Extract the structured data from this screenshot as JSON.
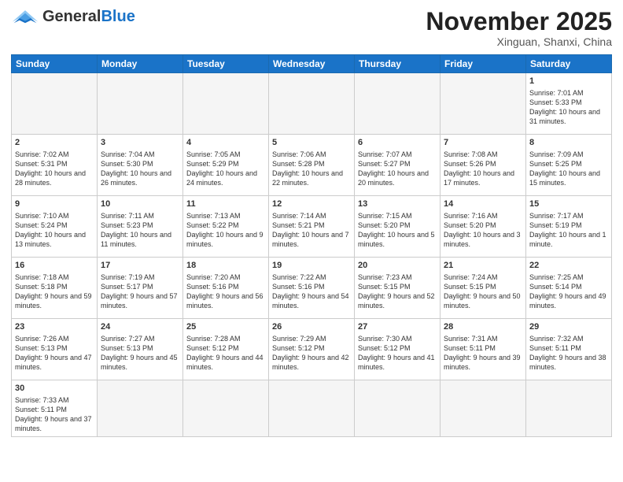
{
  "logo": {
    "general": "General",
    "blue": "Blue"
  },
  "header": {
    "month_title": "November 2025",
    "location": "Xinguan, Shanxi, China"
  },
  "weekdays": [
    "Sunday",
    "Monday",
    "Tuesday",
    "Wednesday",
    "Thursday",
    "Friday",
    "Saturday"
  ],
  "weeks": [
    [
      {
        "day": "",
        "empty": true
      },
      {
        "day": "",
        "empty": true
      },
      {
        "day": "",
        "empty": true
      },
      {
        "day": "",
        "empty": true
      },
      {
        "day": "",
        "empty": true
      },
      {
        "day": "",
        "empty": true
      },
      {
        "day": "1",
        "sunrise": "Sunrise: 7:01 AM",
        "sunset": "Sunset: 5:33 PM",
        "daylight": "Daylight: 10 hours and 31 minutes."
      }
    ],
    [
      {
        "day": "2",
        "sunrise": "Sunrise: 7:02 AM",
        "sunset": "Sunset: 5:31 PM",
        "daylight": "Daylight: 10 hours and 28 minutes."
      },
      {
        "day": "3",
        "sunrise": "Sunrise: 7:04 AM",
        "sunset": "Sunset: 5:30 PM",
        "daylight": "Daylight: 10 hours and 26 minutes."
      },
      {
        "day": "4",
        "sunrise": "Sunrise: 7:05 AM",
        "sunset": "Sunset: 5:29 PM",
        "daylight": "Daylight: 10 hours and 24 minutes."
      },
      {
        "day": "5",
        "sunrise": "Sunrise: 7:06 AM",
        "sunset": "Sunset: 5:28 PM",
        "daylight": "Daylight: 10 hours and 22 minutes."
      },
      {
        "day": "6",
        "sunrise": "Sunrise: 7:07 AM",
        "sunset": "Sunset: 5:27 PM",
        "daylight": "Daylight: 10 hours and 20 minutes."
      },
      {
        "day": "7",
        "sunrise": "Sunrise: 7:08 AM",
        "sunset": "Sunset: 5:26 PM",
        "daylight": "Daylight: 10 hours and 17 minutes."
      },
      {
        "day": "8",
        "sunrise": "Sunrise: 7:09 AM",
        "sunset": "Sunset: 5:25 PM",
        "daylight": "Daylight: 10 hours and 15 minutes."
      }
    ],
    [
      {
        "day": "9",
        "sunrise": "Sunrise: 7:10 AM",
        "sunset": "Sunset: 5:24 PM",
        "daylight": "Daylight: 10 hours and 13 minutes."
      },
      {
        "day": "10",
        "sunrise": "Sunrise: 7:11 AM",
        "sunset": "Sunset: 5:23 PM",
        "daylight": "Daylight: 10 hours and 11 minutes."
      },
      {
        "day": "11",
        "sunrise": "Sunrise: 7:13 AM",
        "sunset": "Sunset: 5:22 PM",
        "daylight": "Daylight: 10 hours and 9 minutes."
      },
      {
        "day": "12",
        "sunrise": "Sunrise: 7:14 AM",
        "sunset": "Sunset: 5:21 PM",
        "daylight": "Daylight: 10 hours and 7 minutes."
      },
      {
        "day": "13",
        "sunrise": "Sunrise: 7:15 AM",
        "sunset": "Sunset: 5:20 PM",
        "daylight": "Daylight: 10 hours and 5 minutes."
      },
      {
        "day": "14",
        "sunrise": "Sunrise: 7:16 AM",
        "sunset": "Sunset: 5:20 PM",
        "daylight": "Daylight: 10 hours and 3 minutes."
      },
      {
        "day": "15",
        "sunrise": "Sunrise: 7:17 AM",
        "sunset": "Sunset: 5:19 PM",
        "daylight": "Daylight: 10 hours and 1 minute."
      }
    ],
    [
      {
        "day": "16",
        "sunrise": "Sunrise: 7:18 AM",
        "sunset": "Sunset: 5:18 PM",
        "daylight": "Daylight: 9 hours and 59 minutes."
      },
      {
        "day": "17",
        "sunrise": "Sunrise: 7:19 AM",
        "sunset": "Sunset: 5:17 PM",
        "daylight": "Daylight: 9 hours and 57 minutes."
      },
      {
        "day": "18",
        "sunrise": "Sunrise: 7:20 AM",
        "sunset": "Sunset: 5:16 PM",
        "daylight": "Daylight: 9 hours and 56 minutes."
      },
      {
        "day": "19",
        "sunrise": "Sunrise: 7:22 AM",
        "sunset": "Sunset: 5:16 PM",
        "daylight": "Daylight: 9 hours and 54 minutes."
      },
      {
        "day": "20",
        "sunrise": "Sunrise: 7:23 AM",
        "sunset": "Sunset: 5:15 PM",
        "daylight": "Daylight: 9 hours and 52 minutes."
      },
      {
        "day": "21",
        "sunrise": "Sunrise: 7:24 AM",
        "sunset": "Sunset: 5:15 PM",
        "daylight": "Daylight: 9 hours and 50 minutes."
      },
      {
        "day": "22",
        "sunrise": "Sunrise: 7:25 AM",
        "sunset": "Sunset: 5:14 PM",
        "daylight": "Daylight: 9 hours and 49 minutes."
      }
    ],
    [
      {
        "day": "23",
        "sunrise": "Sunrise: 7:26 AM",
        "sunset": "Sunset: 5:13 PM",
        "daylight": "Daylight: 9 hours and 47 minutes."
      },
      {
        "day": "24",
        "sunrise": "Sunrise: 7:27 AM",
        "sunset": "Sunset: 5:13 PM",
        "daylight": "Daylight: 9 hours and 45 minutes."
      },
      {
        "day": "25",
        "sunrise": "Sunrise: 7:28 AM",
        "sunset": "Sunset: 5:12 PM",
        "daylight": "Daylight: 9 hours and 44 minutes."
      },
      {
        "day": "26",
        "sunrise": "Sunrise: 7:29 AM",
        "sunset": "Sunset: 5:12 PM",
        "daylight": "Daylight: 9 hours and 42 minutes."
      },
      {
        "day": "27",
        "sunrise": "Sunrise: 7:30 AM",
        "sunset": "Sunset: 5:12 PM",
        "daylight": "Daylight: 9 hours and 41 minutes."
      },
      {
        "day": "28",
        "sunrise": "Sunrise: 7:31 AM",
        "sunset": "Sunset: 5:11 PM",
        "daylight": "Daylight: 9 hours and 39 minutes."
      },
      {
        "day": "29",
        "sunrise": "Sunrise: 7:32 AM",
        "sunset": "Sunset: 5:11 PM",
        "daylight": "Daylight: 9 hours and 38 minutes."
      }
    ],
    [
      {
        "day": "30",
        "sunrise": "Sunrise: 7:33 AM",
        "sunset": "Sunset: 5:11 PM",
        "daylight": "Daylight: 9 hours and 37 minutes."
      },
      {
        "day": "",
        "empty": true
      },
      {
        "day": "",
        "empty": true
      },
      {
        "day": "",
        "empty": true
      },
      {
        "day": "",
        "empty": true
      },
      {
        "day": "",
        "empty": true
      },
      {
        "day": "",
        "empty": true
      }
    ]
  ]
}
